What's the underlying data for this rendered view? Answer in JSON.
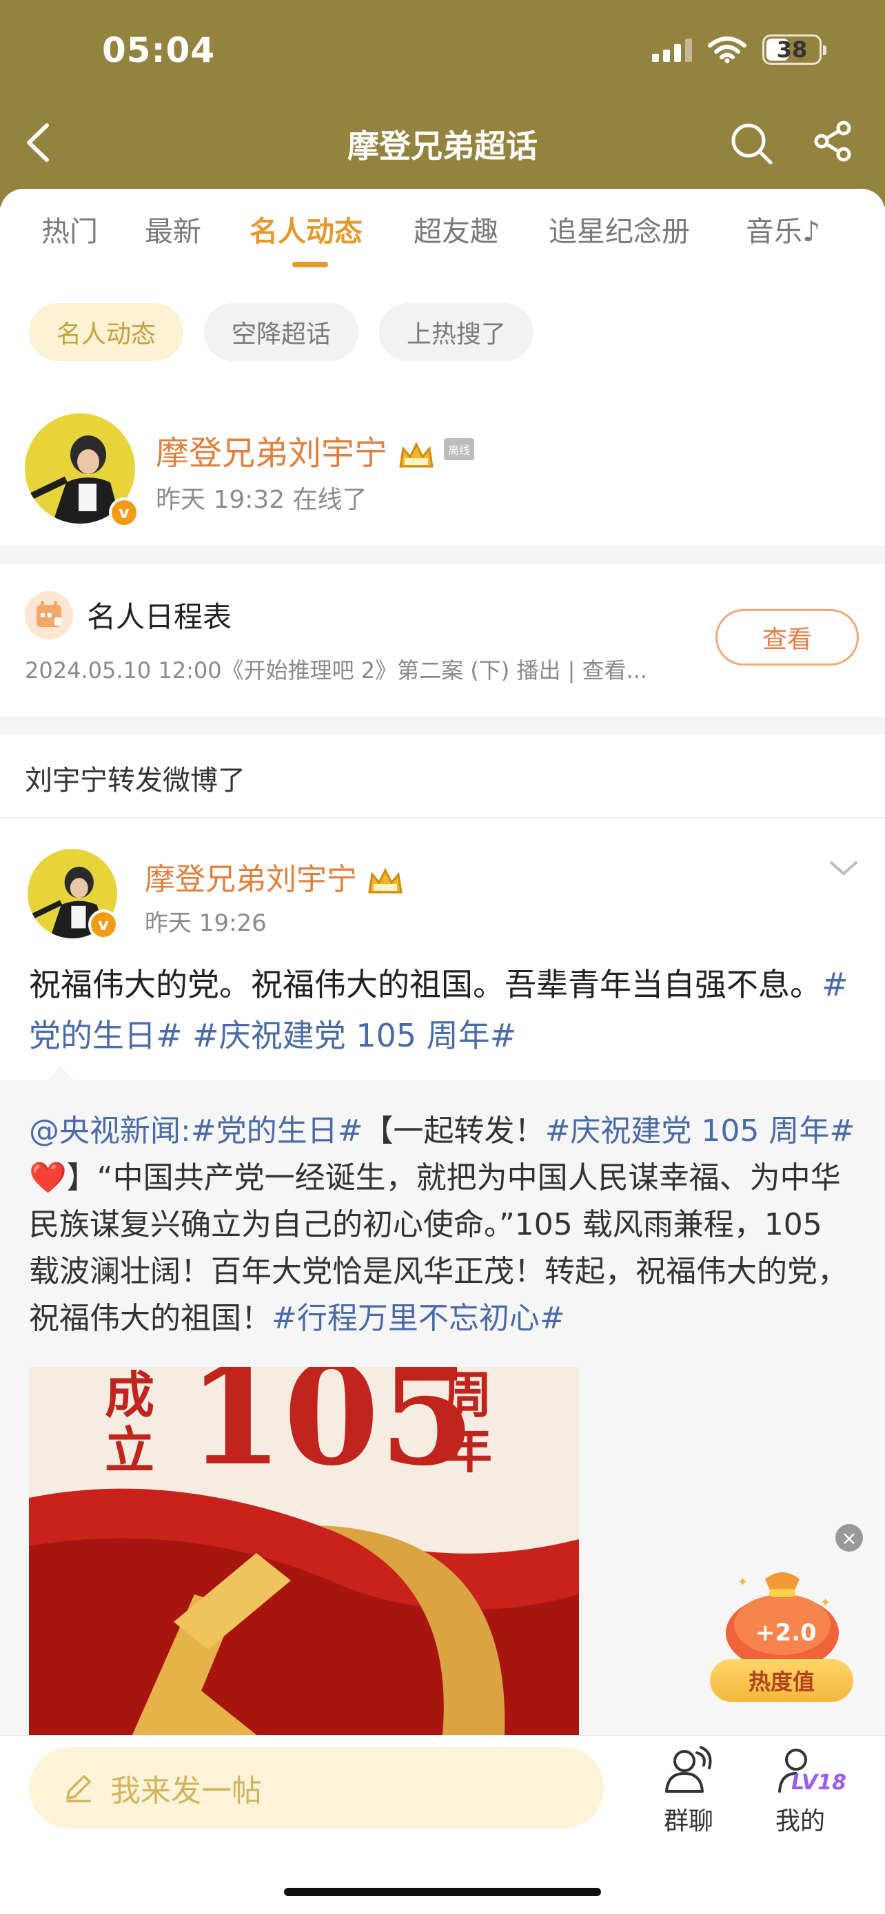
{
  "status_bar": {
    "time": "05:04",
    "battery": "38"
  },
  "nav": {
    "title": "摩登兄弟超话"
  },
  "tabs": [
    {
      "label": "热门"
    },
    {
      "label": "最新"
    },
    {
      "label": "名人动态"
    },
    {
      "label": "超友趣"
    },
    {
      "label": "追星纪念册"
    },
    {
      "label": "音乐"
    }
  ],
  "active_tab_index": 2,
  "chips": [
    {
      "label": "名人动态"
    },
    {
      "label": "空降超话"
    },
    {
      "label": "上热搜了"
    }
  ],
  "celebrity": {
    "name": "摩登兄弟刘宇宁",
    "status_tag": "离线",
    "last_online": "昨天 19:32 在线了"
  },
  "schedule": {
    "title": "名人日程表",
    "desc": "2024.05.10 12:00《开始推理吧 2》第二案 (下) 播出 |  查看...",
    "button": "查看"
  },
  "repost_header": "刘宇宁转发微博了",
  "post": {
    "author": "摩登兄弟刘宇宁",
    "time": "昨天 19:26",
    "text": "祝福伟大的党。祝福伟大的祖国。吾辈青年当自强不息。",
    "tags": [
      "#党的生日#",
      "#庆祝建党 105 周年#"
    ],
    "quote": {
      "mention": "@央视新闻",
      "tag1": "#党的生日#",
      "lead": "【一起转发！",
      "tag2": "#庆祝建党 105 周年#",
      "heart": "❤️",
      "body": "】“中国共产党一经诞生，就把为中国人民谋幸福、为中华民族谋复兴确立为自己的初心使命。”105 载风雨兼程，105 载波澜壮阔！百年大党恰是风华正茂！转起，祝福伟大的党，祝福伟大的祖国！",
      "tag3": "#行程万里不忘初心#"
    },
    "image_text": {
      "left_top": "成",
      "left_bottom": "立",
      "number": "105",
      "right_top": "周",
      "right_bottom": "年"
    }
  },
  "floating_widget": {
    "value": "+2.0",
    "label": "热度值"
  },
  "bottom_bar": {
    "compose_placeholder": "我来发一帖",
    "group_chat": "群聊",
    "mine": "我的",
    "level": "LV18"
  },
  "colors": {
    "header": "#94823f",
    "accent": "#e59a2e",
    "name": "#e0803f",
    "link": "#4a6ba8"
  }
}
